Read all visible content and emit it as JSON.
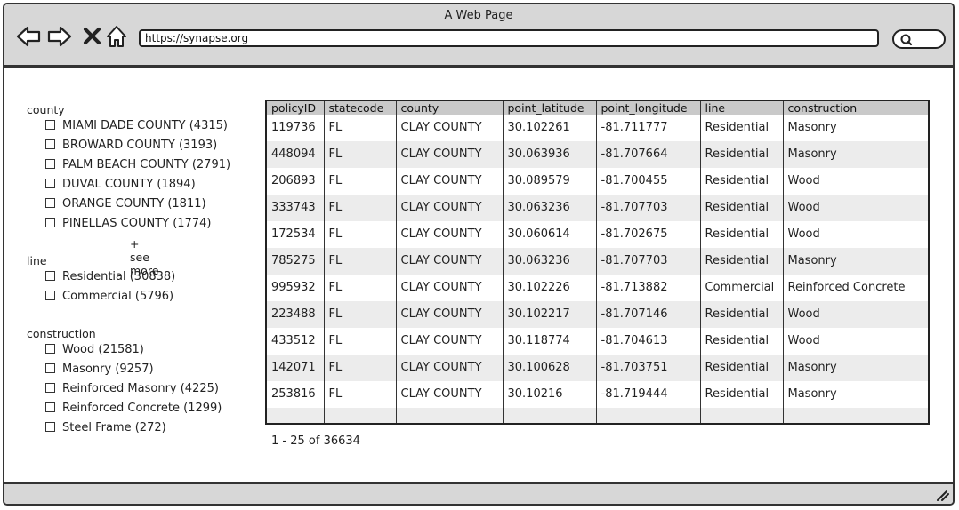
{
  "window": {
    "title": "A Web Page"
  },
  "browser": {
    "url": "https://synapse.org"
  },
  "facets": [
    {
      "title": "county",
      "options": [
        "MIAMI DADE COUNTY (4315)",
        "BROWARD COUNTY (3193)",
        "PALM BEACH COUNTY (2791)",
        "DUVAL COUNTY (1894)",
        "ORANGE COUNTY (1811)",
        "PINELLAS COUNTY (1774)"
      ],
      "see_more": "+ see more"
    },
    {
      "title": "line",
      "options": [
        "Residential (30838)",
        "Commercial (5796)"
      ]
    },
    {
      "title": "construction",
      "options": [
        "Wood (21581)",
        "Masonry (9257)",
        "Reinforced Masonry (4225)",
        "Reinforced Concrete (1299)",
        "Steel Frame (272)"
      ]
    }
  ],
  "table": {
    "columns": [
      "policyID",
      "statecode",
      "county",
      "point_latitude",
      "point_longitude",
      "line",
      "construction"
    ],
    "rows": [
      [
        "119736",
        "FL",
        "CLAY COUNTY",
        "30.102261",
        "-81.711777",
        "Residential",
        "Masonry"
      ],
      [
        "448094",
        "FL",
        "CLAY COUNTY",
        "30.063936",
        "-81.707664",
        "Residential",
        "Masonry"
      ],
      [
        "206893",
        "FL",
        "CLAY COUNTY",
        "30.089579",
        "-81.700455",
        "Residential",
        "Wood"
      ],
      [
        "333743",
        "FL",
        "CLAY COUNTY",
        "30.063236",
        "-81.707703",
        "Residential",
        "Wood"
      ],
      [
        "172534",
        "FL",
        "CLAY COUNTY",
        "30.060614",
        "-81.702675",
        "Residential",
        "Wood"
      ],
      [
        "785275",
        "FL",
        "CLAY COUNTY",
        "30.063236",
        "-81.707703",
        "Residential",
        "Masonry"
      ],
      [
        "995932",
        "FL",
        "CLAY COUNTY",
        "30.102226",
        "-81.713882",
        "Commercial",
        "Reinforced Concrete"
      ],
      [
        "223488",
        "FL",
        "CLAY COUNTY",
        "30.102217",
        "-81.707146",
        "Residential",
        "Wood"
      ],
      [
        "433512",
        "FL",
        "CLAY COUNTY",
        "30.118774",
        "-81.704613",
        "Residential",
        "Wood"
      ],
      [
        "142071",
        "FL",
        "CLAY COUNTY",
        "30.100628",
        "-81.703751",
        "Residential",
        "Masonry"
      ],
      [
        "253816",
        "FL",
        "CLAY COUNTY",
        "30.10216",
        "-81.719444",
        "Residential",
        "Masonry"
      ],
      [
        "",
        "",
        "",
        "",
        "",
        "",
        ""
      ]
    ]
  },
  "pager": {
    "text": "1 - 25 of 36634"
  },
  "icons": {
    "back": "back-arrow-icon",
    "forward": "forward-arrow-icon",
    "stop": "close-icon",
    "home": "home-icon",
    "search": "search-icon",
    "resize": "resize-grip-icon"
  }
}
